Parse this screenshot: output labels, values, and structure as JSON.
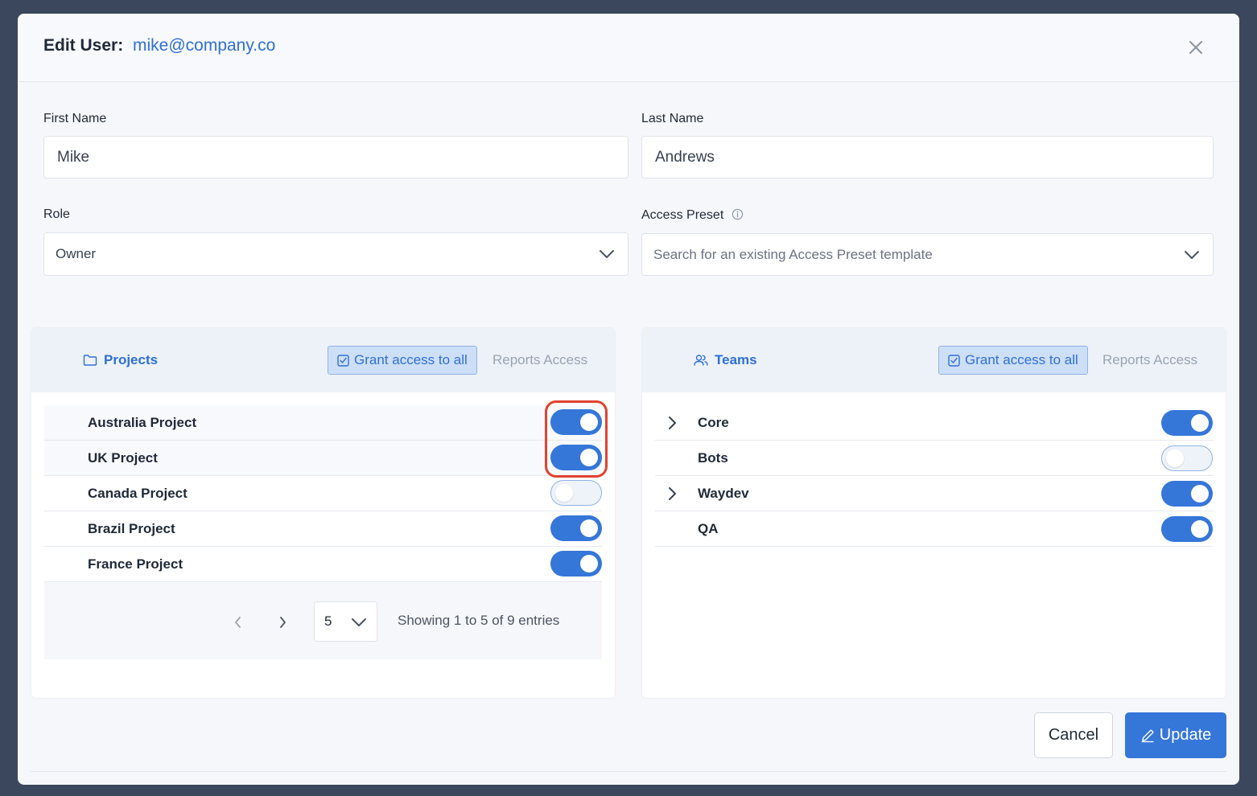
{
  "header": {
    "title": "Edit User:",
    "email": "mike@company.co"
  },
  "form": {
    "first_name_label": "First Name",
    "first_name_value": "Mike",
    "last_name_label": "Last Name",
    "last_name_value": "Andrews",
    "role_label": "Role",
    "role_value": "Owner",
    "access_preset_label": "Access Preset",
    "access_preset_placeholder": "Search for an existing Access Preset template"
  },
  "projects": {
    "title": "Projects",
    "grant_label": "Grant access to all",
    "reports_label": "Reports Access",
    "items": [
      {
        "label": "Australia Project",
        "enabled": true
      },
      {
        "label": "UK Project",
        "enabled": true
      },
      {
        "label": "Canada Project",
        "enabled": false
      },
      {
        "label": "Brazil Project",
        "enabled": true
      },
      {
        "label": "France Project",
        "enabled": true
      }
    ],
    "page_size": "5",
    "pager_info": "Showing 1 to 5 of 9 entries"
  },
  "teams": {
    "title": "Teams",
    "grant_label": "Grant access to all",
    "reports_label": "Reports Access",
    "items": [
      {
        "label": "Core",
        "enabled": true,
        "expandable": true
      },
      {
        "label": "Bots",
        "enabled": false,
        "expandable": false
      },
      {
        "label": "Waydev",
        "enabled": true,
        "expandable": true
      },
      {
        "label": "QA",
        "enabled": true,
        "expandable": false
      }
    ]
  },
  "actions": {
    "cancel_label": "Cancel",
    "update_label": "Update"
  },
  "colors": {
    "accent": "#3576d9",
    "highlight": "#e0432f",
    "overlay": "#3a475c"
  },
  "icons": [
    "close-icon",
    "info-icon",
    "folder-icon",
    "users-icon",
    "checkbox-icon",
    "chevron-down-icon",
    "chevron-right-icon",
    "chevron-left-icon",
    "pencil-icon"
  ]
}
